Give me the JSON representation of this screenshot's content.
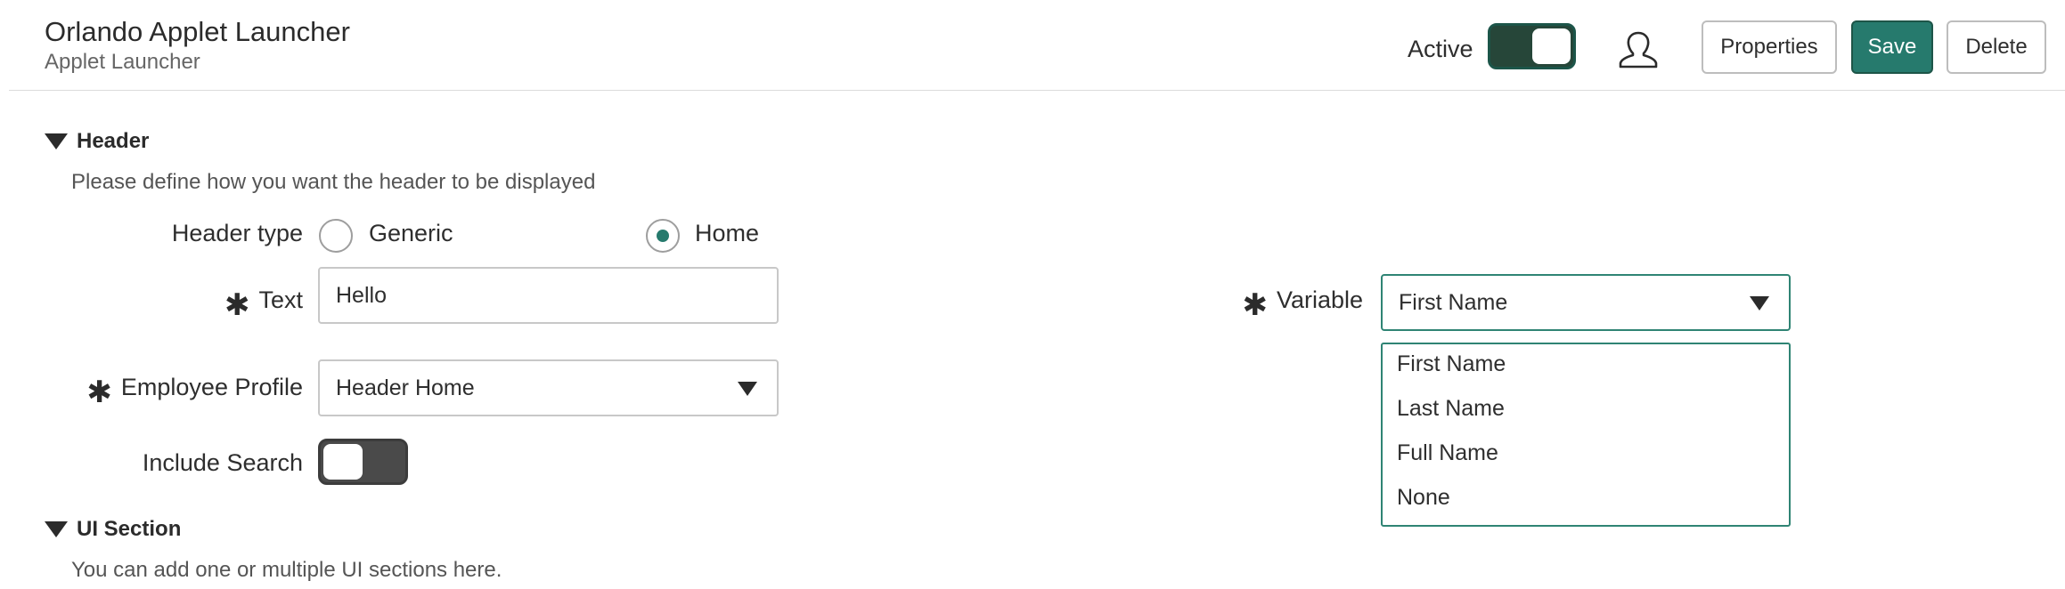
{
  "header": {
    "title": "Orlando Applet Launcher",
    "subtitle": "Applet Launcher",
    "active_label": "Active",
    "active_on": true,
    "user_icon": "user-icon",
    "buttons": {
      "properties": "Properties",
      "save": "Save",
      "delete": "Delete"
    },
    "colors": {
      "primary": "#267a6d",
      "toggle_on": "#264639",
      "focus": "#2f8474"
    }
  },
  "sections": {
    "header": {
      "title": "Header",
      "description": "Please define how you want the header to be displayed",
      "header_type": {
        "label": "Header type",
        "options": [
          "Generic",
          "Home"
        ],
        "selected": "Home"
      },
      "text": {
        "label": "Text",
        "value": "Hello"
      },
      "variable": {
        "label": "Variable",
        "value": "First Name",
        "options": [
          "First Name",
          "Last Name",
          "Full Name",
          "None"
        ]
      },
      "employee_profile": {
        "label": "Employee Profile",
        "value": "Header Home"
      },
      "include_search": {
        "label": "Include Search",
        "on": false
      }
    },
    "ui_section": {
      "title": "UI Section",
      "description": "You can add one or multiple UI sections here."
    }
  }
}
